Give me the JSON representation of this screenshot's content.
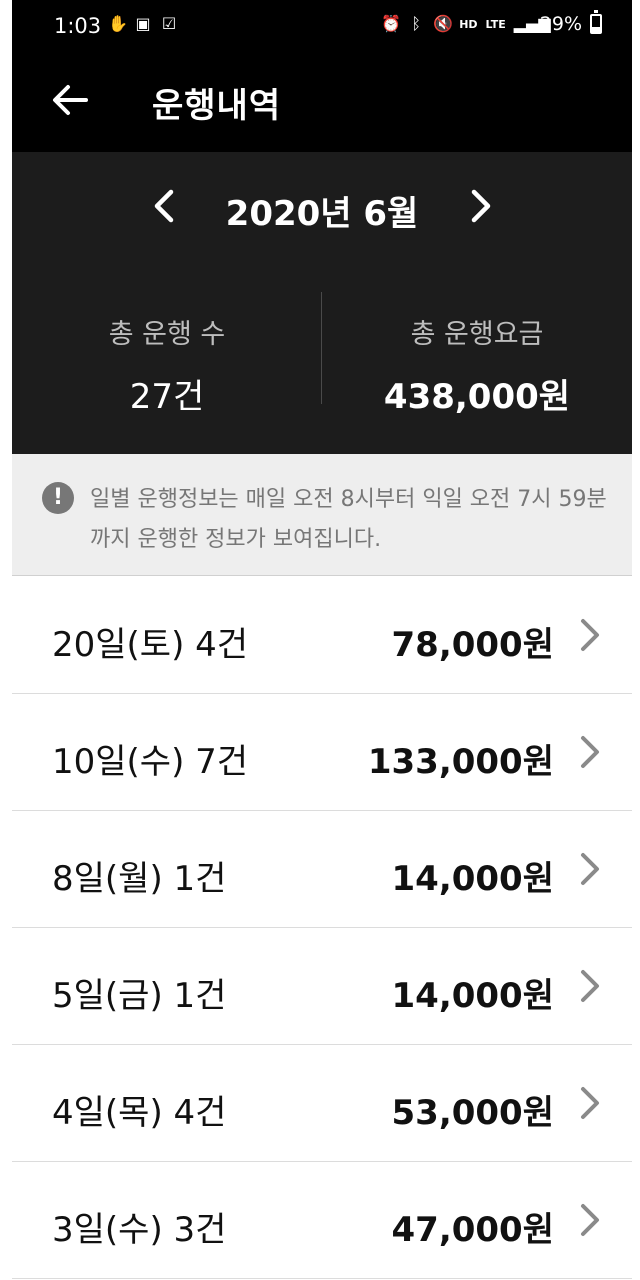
{
  "status_bar": {
    "time": "1:03",
    "network": "LTE",
    "voice": "HD",
    "battery": "29%",
    "battery_level": 0.29
  },
  "header": {
    "title": "운행내역"
  },
  "summary": {
    "month": "2020년 6월",
    "total_trips_label": "총 운행 수",
    "total_trips_value": "27건",
    "total_fare_label": "총 운행요금",
    "total_fare_value": "438,000원"
  },
  "notice": {
    "text": "일별 운행정보는 매일 오전 8시부터 익일 오전 7시 59분까지 운행한 정보가 보여집니다."
  },
  "days": [
    {
      "label": "20일(토) 4건",
      "amount": "78,000원"
    },
    {
      "label": "10일(수) 7건",
      "amount": "133,000원"
    },
    {
      "label": "8일(월) 1건",
      "amount": "14,000원"
    },
    {
      "label": "5일(금) 1건",
      "amount": "14,000원"
    },
    {
      "label": "4일(목) 4건",
      "amount": "53,000원"
    },
    {
      "label": "3일(수) 3건",
      "amount": "47,000원"
    }
  ],
  "colors": {
    "header_bg": "#000000",
    "summary_bg": "#1c1c1c",
    "notice_bg": "#eeeeee",
    "chevron": "#8a8a8a"
  }
}
